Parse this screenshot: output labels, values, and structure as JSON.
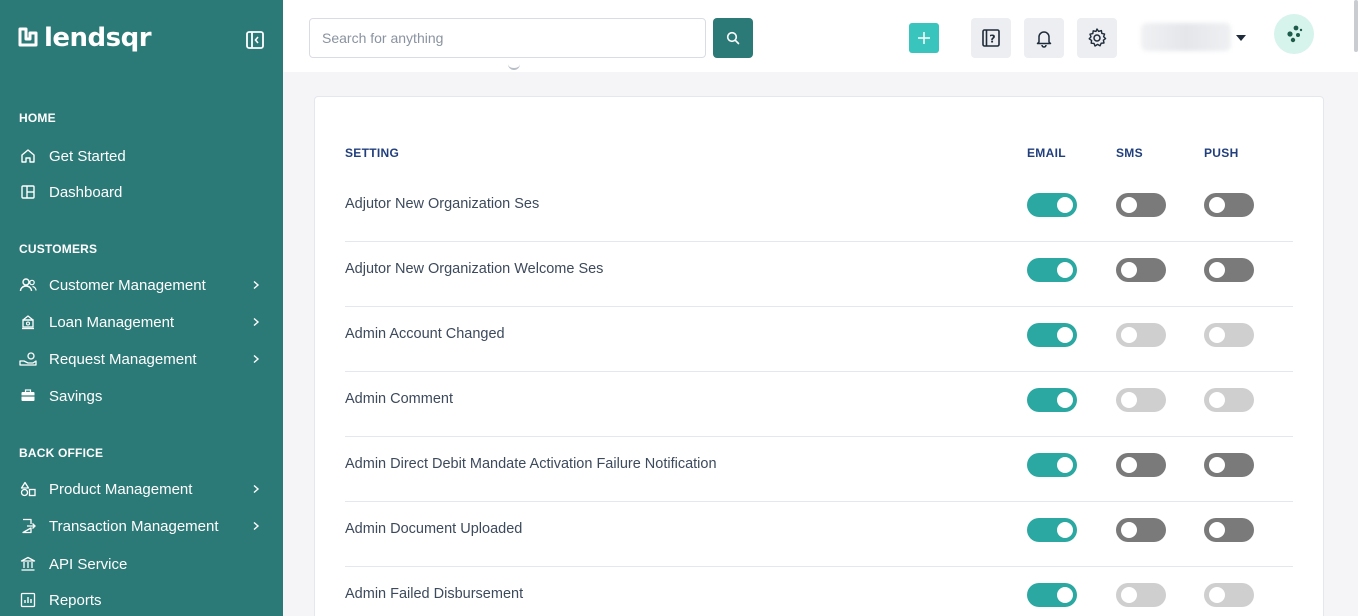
{
  "brand": {
    "name": "lendsqr"
  },
  "search": {
    "placeholder": "Search for anything"
  },
  "sidebar": {
    "sections": [
      {
        "title": "HOME",
        "items": [
          {
            "label": "Get Started",
            "icon": "home-icon",
            "chevron": false
          },
          {
            "label": "Dashboard",
            "icon": "dashboard-icon",
            "chevron": false
          }
        ]
      },
      {
        "title": "CUSTOMERS",
        "items": [
          {
            "label": "Customer Management",
            "icon": "users-icon",
            "chevron": true
          },
          {
            "label": "Loan Management",
            "icon": "loan-icon",
            "chevron": true
          },
          {
            "label": "Request Management",
            "icon": "request-icon",
            "chevron": true
          },
          {
            "label": "Savings",
            "icon": "savings-icon",
            "chevron": false
          }
        ]
      },
      {
        "title": "BACK OFFICE",
        "items": [
          {
            "label": "Product Management",
            "icon": "product-icon",
            "chevron": true
          },
          {
            "label": "Transaction Management",
            "icon": "transaction-icon",
            "chevron": true
          },
          {
            "label": "API Service",
            "icon": "api-icon",
            "chevron": false
          },
          {
            "label": "Reports",
            "icon": "reports-icon",
            "chevron": false
          }
        ]
      }
    ]
  },
  "table": {
    "headers": {
      "setting": "SETTING",
      "email": "EMAIL",
      "sms": "SMS",
      "push": "PUSH"
    },
    "rows": [
      {
        "label": "Adjutor New Organization Ses",
        "email": "on",
        "sms": "off",
        "push": "off"
      },
      {
        "label": "Adjutor New Organization Welcome Ses",
        "email": "on",
        "sms": "off",
        "push": "off"
      },
      {
        "label": "Admin Account Changed",
        "email": "on",
        "sms": "disabled",
        "push": "disabled"
      },
      {
        "label": "Admin Comment",
        "email": "on",
        "sms": "disabled",
        "push": "disabled"
      },
      {
        "label": "Admin Direct Debit Mandate Activation Failure Notification",
        "email": "on",
        "sms": "off",
        "push": "off"
      },
      {
        "label": "Admin Document Uploaded",
        "email": "on",
        "sms": "off",
        "push": "off"
      },
      {
        "label": "Admin Failed Disbursement",
        "email": "on",
        "sms": "disabled",
        "push": "disabled"
      }
    ]
  },
  "colors": {
    "sidebar": "#2c7a78",
    "accent": "#39c5bd",
    "toggle_on": "#2aa8a1",
    "toggle_off": "#7a7a7a",
    "toggle_disabled": "#cfcfcf",
    "header_text": "#213f7d"
  }
}
